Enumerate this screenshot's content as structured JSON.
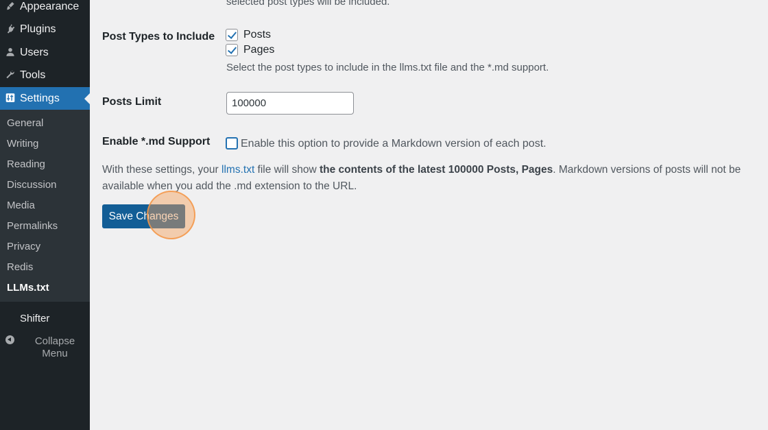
{
  "sidebar": {
    "menu": [
      {
        "label": "Appearance",
        "icon": "appearance-brush-icon"
      },
      {
        "label": "Plugins",
        "icon": "plugins-plug-icon"
      },
      {
        "label": "Users",
        "icon": "users-person-icon"
      },
      {
        "label": "Tools",
        "icon": "tools-wrench-icon"
      },
      {
        "label": "Settings",
        "icon": "settings-sliders-icon"
      }
    ],
    "submenu": [
      "General",
      "Writing",
      "Reading",
      "Discussion",
      "Media",
      "Permalinks",
      "Privacy",
      "Redis",
      "LLMs.txt"
    ],
    "current_submenu": "LLMs.txt",
    "shifter": "Shifter",
    "collapse_label": "Collapse Menu"
  },
  "settings": {
    "top_desc": "selected post types will be included.",
    "post_types": {
      "label": "Post Types to Include",
      "options": [
        {
          "label": "Posts",
          "checked": true
        },
        {
          "label": "Pages",
          "checked": true
        }
      ],
      "desc": "Select the post types to include in the llms.txt file and the *.md support."
    },
    "posts_limit": {
      "label": "Posts Limit",
      "value": "100000"
    },
    "md_support": {
      "label": "Enable *.md Support",
      "checked": false,
      "option_label": "Enable this option to provide a Markdown version of each post."
    },
    "summary": {
      "prefix": "With these settings, your ",
      "link": "llms.txt",
      "middle": " file will show ",
      "bold": "the contents of the latest 100000 Posts, Pages",
      "suffix": ". Markdown versions of posts will not be available when you add the .md extension to the URL."
    },
    "save_label": "Save Changes"
  },
  "colors": {
    "sidebar_bg": "#1d2327",
    "submenu_bg": "#2c3338",
    "accent": "#2271b1",
    "button": "#135e96",
    "click_highlight": "#f5a05a"
  }
}
